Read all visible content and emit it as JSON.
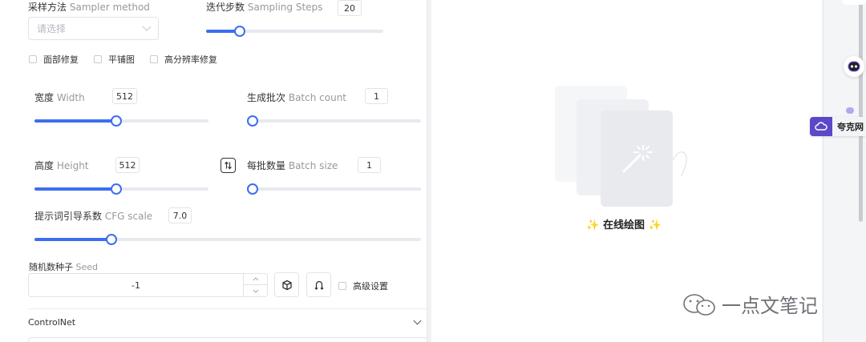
{
  "sampler": {
    "label": "采样方法",
    "label_en": "Sampler method",
    "placeholder": "请选择"
  },
  "steps": {
    "label": "迭代步数",
    "label_en": "Sampling Steps",
    "value": "20",
    "fraction": 0.19
  },
  "options": [
    {
      "label": "面部修复",
      "checked": false
    },
    {
      "label": "平铺图",
      "checked": false
    },
    {
      "label": "高分辨率修复",
      "checked": false
    }
  ],
  "width": {
    "label": "宽度",
    "label_en": "Width",
    "value": "512",
    "fraction": 0.47
  },
  "batch_count": {
    "label": "生成批次",
    "label_en": "Batch count",
    "value": "1",
    "fraction": 0.0
  },
  "height": {
    "label": "高度",
    "label_en": "Height",
    "value": "512",
    "fraction": 0.47
  },
  "batch_size": {
    "label": "每批数量",
    "label_en": "Batch size",
    "value": "1",
    "fraction": 0.0
  },
  "cfg": {
    "label": "提示词引导系数",
    "label_en": "CFG scale",
    "value": "7.0",
    "fraction": 0.2
  },
  "seed": {
    "label": "随机数种子",
    "label_en": "Seed",
    "value": "-1"
  },
  "advanced": {
    "label": "高级设置",
    "checked": false
  },
  "controlnet": {
    "label": "ControlNet"
  },
  "preview": {
    "title": "在线绘图",
    "spark": "✨"
  },
  "watermark": {
    "text": "一点文笔记"
  },
  "side": {
    "kuake_label": "夸克网"
  },
  "colors": {
    "accent": "#3d6ef0",
    "kuake": "#5b48c9"
  }
}
